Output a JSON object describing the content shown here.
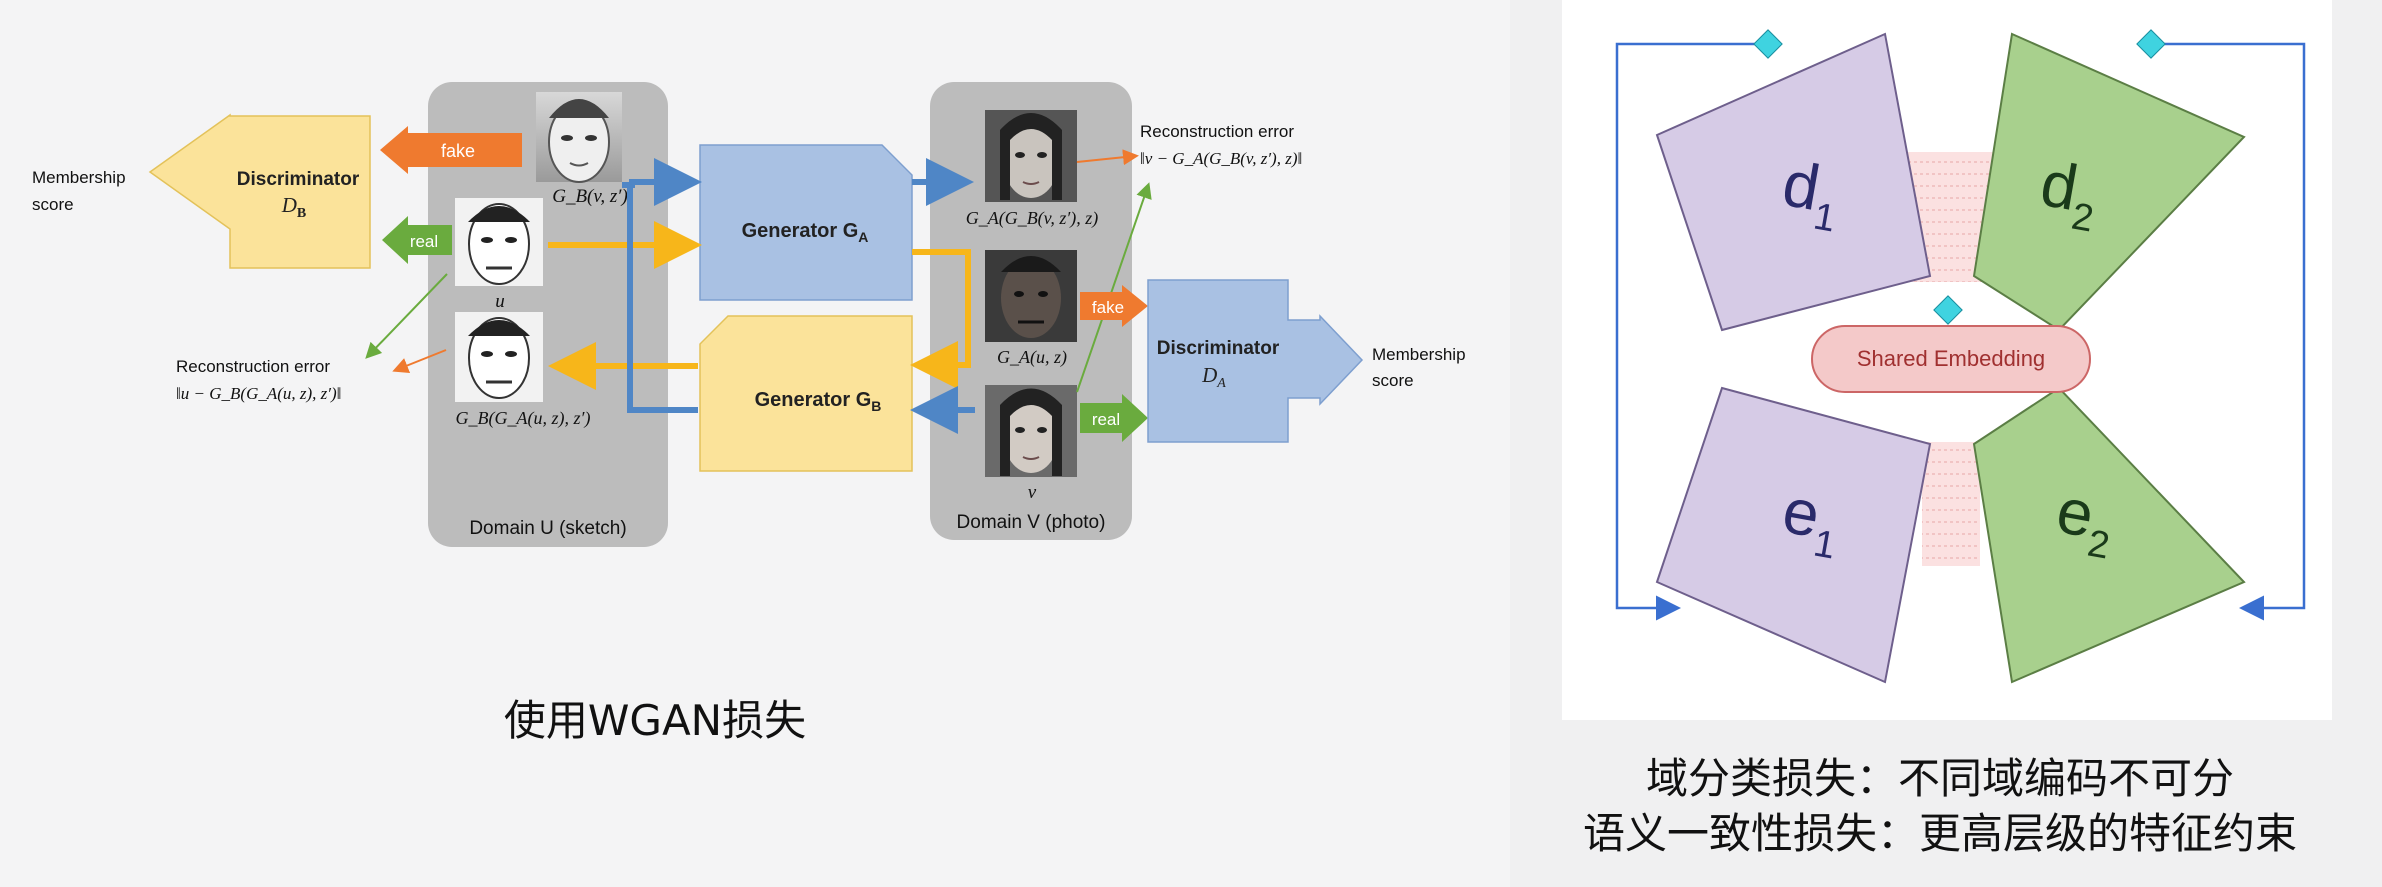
{
  "left_diagram": {
    "membership_left": [
      "Membership",
      "score"
    ],
    "membership_right": [
      "Membership",
      "score"
    ],
    "discriminator_b": {
      "title": "Discriminator",
      "symbol": "D",
      "sub": "B"
    },
    "discriminator_a": {
      "title": "Discriminator",
      "symbol": "D",
      "sub": "A"
    },
    "generator_a": {
      "title": "Generator G",
      "sub": "A"
    },
    "generator_b": {
      "title": "Generator G",
      "sub": "B"
    },
    "fake_label": "fake",
    "real_label": "real",
    "domain_u": "Domain U (sketch)",
    "domain_v": "Domain V (photo)",
    "recon_error_title": "Reconstruction error",
    "recon_error_u": "‖u − G_B(G_A(u, z), z′)‖",
    "recon_error_v": "‖v − G_A(G_B(v, z′), z)‖",
    "face_labels": {
      "gb_v": "G_B(v, z′)",
      "u": "u",
      "gb_ga_u": "G_B(G_A(u, z), z′)",
      "ga_gb_v": "G_A(G_B(v, z′), z)",
      "ga_u": "G_A(u, z)",
      "v": "v"
    }
  },
  "caption_left": "使用WGAN损失",
  "right_diagram": {
    "d1": "d",
    "d1_sub": "1",
    "d2": "d",
    "d2_sub": "2",
    "e1": "e",
    "e1_sub": "1",
    "e2": "e",
    "e2_sub": "2",
    "shared_embedding": "Shared Embedding"
  },
  "caption_right_1": "域分类损失：不同域编码不可分",
  "caption_right_2": "语义一致性损失：更高层级的特征约束",
  "colors": {
    "discriminator": "#fbe39a",
    "generator_a": "#a9c1e3",
    "generator_b": "#fbe39a",
    "domain_panel": "#bcbcbc",
    "fake_arrow": "#ef7a2f",
    "real_arrow": "#6aab3e",
    "flow_yellow": "#f7b61a",
    "flow_blue": "#4f86c6",
    "decoder_purple": "#d6cbe6",
    "encoder_green": "#a8d08d",
    "shared_embedding_fill": "#f4c9c9",
    "diamond": "#3fd3e0"
  }
}
